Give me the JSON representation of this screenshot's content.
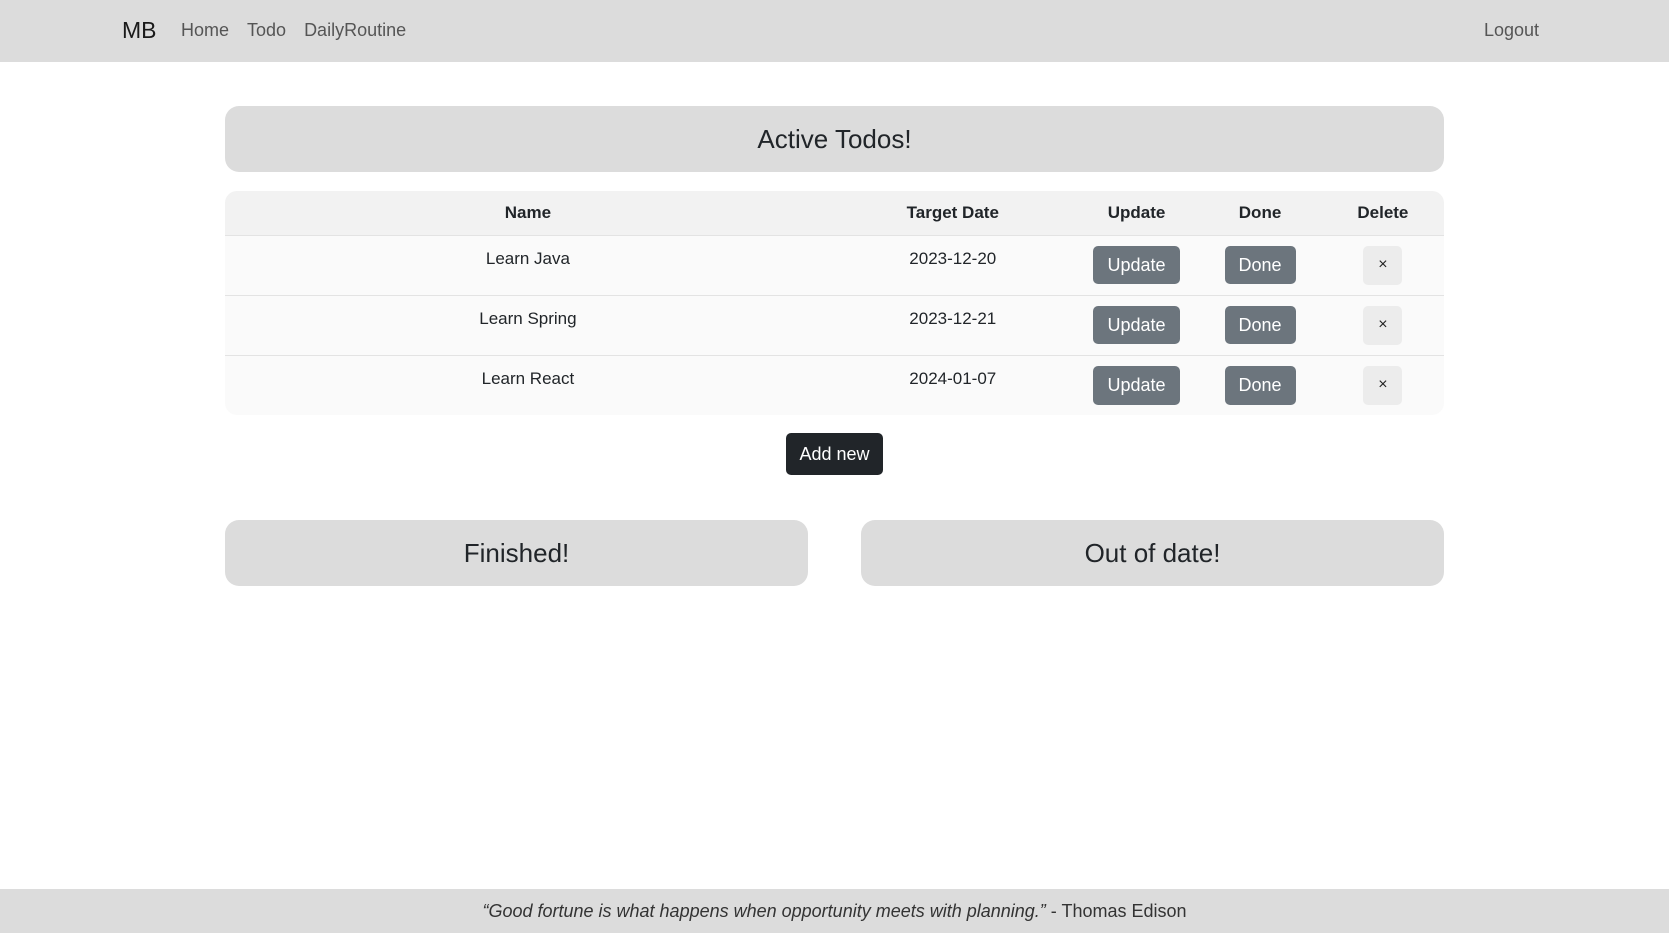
{
  "navbar": {
    "brand": "MB",
    "links": [
      "Home",
      "Todo",
      "DailyRoutine"
    ],
    "logout": "Logout"
  },
  "active_section": {
    "title": "Active Todos!"
  },
  "table": {
    "headers": [
      "Name",
      "Target Date",
      "Update",
      "Done",
      "Delete"
    ],
    "rows": [
      {
        "name": "Learn Java",
        "target_date": "2023-12-20",
        "update": "Update",
        "done": "Done",
        "delete": "×"
      },
      {
        "name": "Learn Spring",
        "target_date": "2023-12-21",
        "update": "Update",
        "done": "Done",
        "delete": "×"
      },
      {
        "name": "Learn React",
        "target_date": "2024-01-07",
        "update": "Update",
        "done": "Done",
        "delete": "×"
      }
    ]
  },
  "add_new_label": "Add new",
  "finished_section": {
    "title": "Finished!"
  },
  "out_of_date_section": {
    "title": "Out of date!"
  },
  "footer": {
    "quote": "“Good fortune is what happens when opportunity meets with planning.”",
    "author": " - Thomas Edison"
  },
  "colors": {
    "navbar_bg": "#dcdcdc",
    "button_grey": "#6c757d",
    "button_dark": "#212529"
  }
}
